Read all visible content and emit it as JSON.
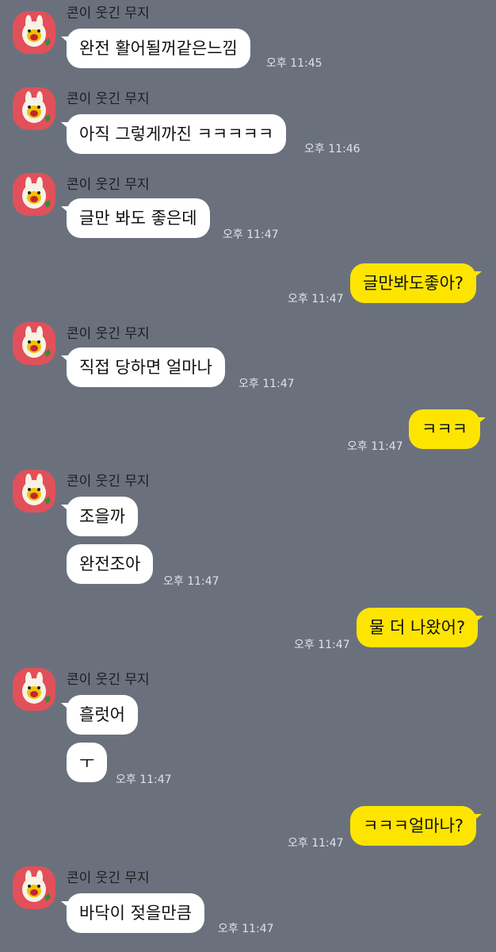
{
  "colors": {
    "background": "#6a717d",
    "incoming_bubble": "#ffffff",
    "outgoing_bubble": "#fee500",
    "avatar_bg": "#e2505a"
  },
  "sender_name": "콘이 웃긴 무지",
  "messages": [
    {
      "dir": "in",
      "show_header": true,
      "text": "완전 활어될꺼같은느낌",
      "time": "오후 11:45"
    },
    {
      "dir": "in",
      "show_header": true,
      "text": "아직 그렇게까진 ㅋㅋㅋㅋㅋ",
      "time": "오후 11:46"
    },
    {
      "dir": "in",
      "show_header": true,
      "text": "글만 봐도 좋은데",
      "time": "오후 11:47"
    },
    {
      "dir": "out",
      "text": "글만봐도좋아?",
      "time": "오후 11:47"
    },
    {
      "dir": "in",
      "show_header": true,
      "text": "직접 당하면 얼마나",
      "time": "오후 11:47"
    },
    {
      "dir": "out",
      "text": "ㅋㅋㅋ",
      "time": "오후 11:47"
    },
    {
      "dir": "in",
      "show_header": true,
      "text": "조을까",
      "time": ""
    },
    {
      "dir": "in",
      "show_header": false,
      "text": "완전조아",
      "time": "오후 11:47"
    },
    {
      "dir": "out",
      "text": "물 더 나왔어?",
      "time": "오후 11:47"
    },
    {
      "dir": "in",
      "show_header": true,
      "text": "흘럿어",
      "time": ""
    },
    {
      "dir": "in",
      "show_header": false,
      "text": "ㅜ",
      "time": "오후 11:47"
    },
    {
      "dir": "out",
      "text": "ㅋㅋㅋ얼마나?",
      "time": "오후 11:47"
    },
    {
      "dir": "in",
      "show_header": true,
      "text": "바닥이 젖을만큼",
      "time": "오후 11:47"
    }
  ]
}
